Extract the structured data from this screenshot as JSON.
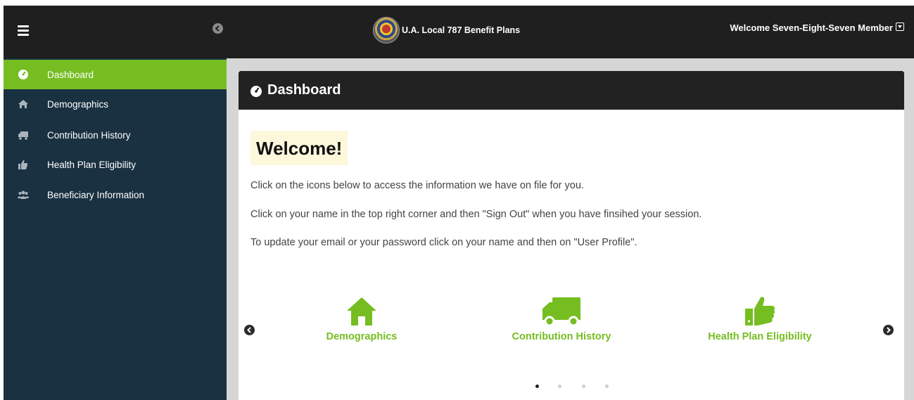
{
  "brand": {
    "title": "U.A. Local 787 Benefit Plans"
  },
  "user_menu": {
    "label": "Welcome Seven-Eight-Seven Member"
  },
  "sidebar": {
    "items": [
      {
        "label": "Dashboard",
        "icon": "dashboard-icon",
        "active": true
      },
      {
        "label": "Demographics",
        "icon": "home-icon",
        "active": false
      },
      {
        "label": "Contribution History",
        "icon": "truck-icon",
        "active": false
      },
      {
        "label": "Health Plan Eligibility",
        "icon": "thumbs-up-icon",
        "active": false
      },
      {
        "label": "Beneficiary Information",
        "icon": "users-icon",
        "active": false
      }
    ]
  },
  "panel": {
    "title": "Dashboard"
  },
  "content": {
    "heading": "Welcome!",
    "lines": [
      "Click on the icons below to access the information we have on file for you.",
      "Click on your name in the top right corner and then \"Sign Out\" when you have finsihed your session.",
      "To update your email or your password click on your name and then on \"User Profile\"."
    ]
  },
  "carousel": {
    "tiles": [
      {
        "label": "Demographics",
        "icon": "home-icon"
      },
      {
        "label": "Contribution History",
        "icon": "truck-icon"
      },
      {
        "label": "Health Plan Eligibility",
        "icon": "thumbs-up-icon"
      }
    ],
    "page_count": 4,
    "active_page": 1
  },
  "colors": {
    "accent": "#76bd22",
    "sidebar": "#1a3142",
    "topbar": "#1f1f1f"
  }
}
